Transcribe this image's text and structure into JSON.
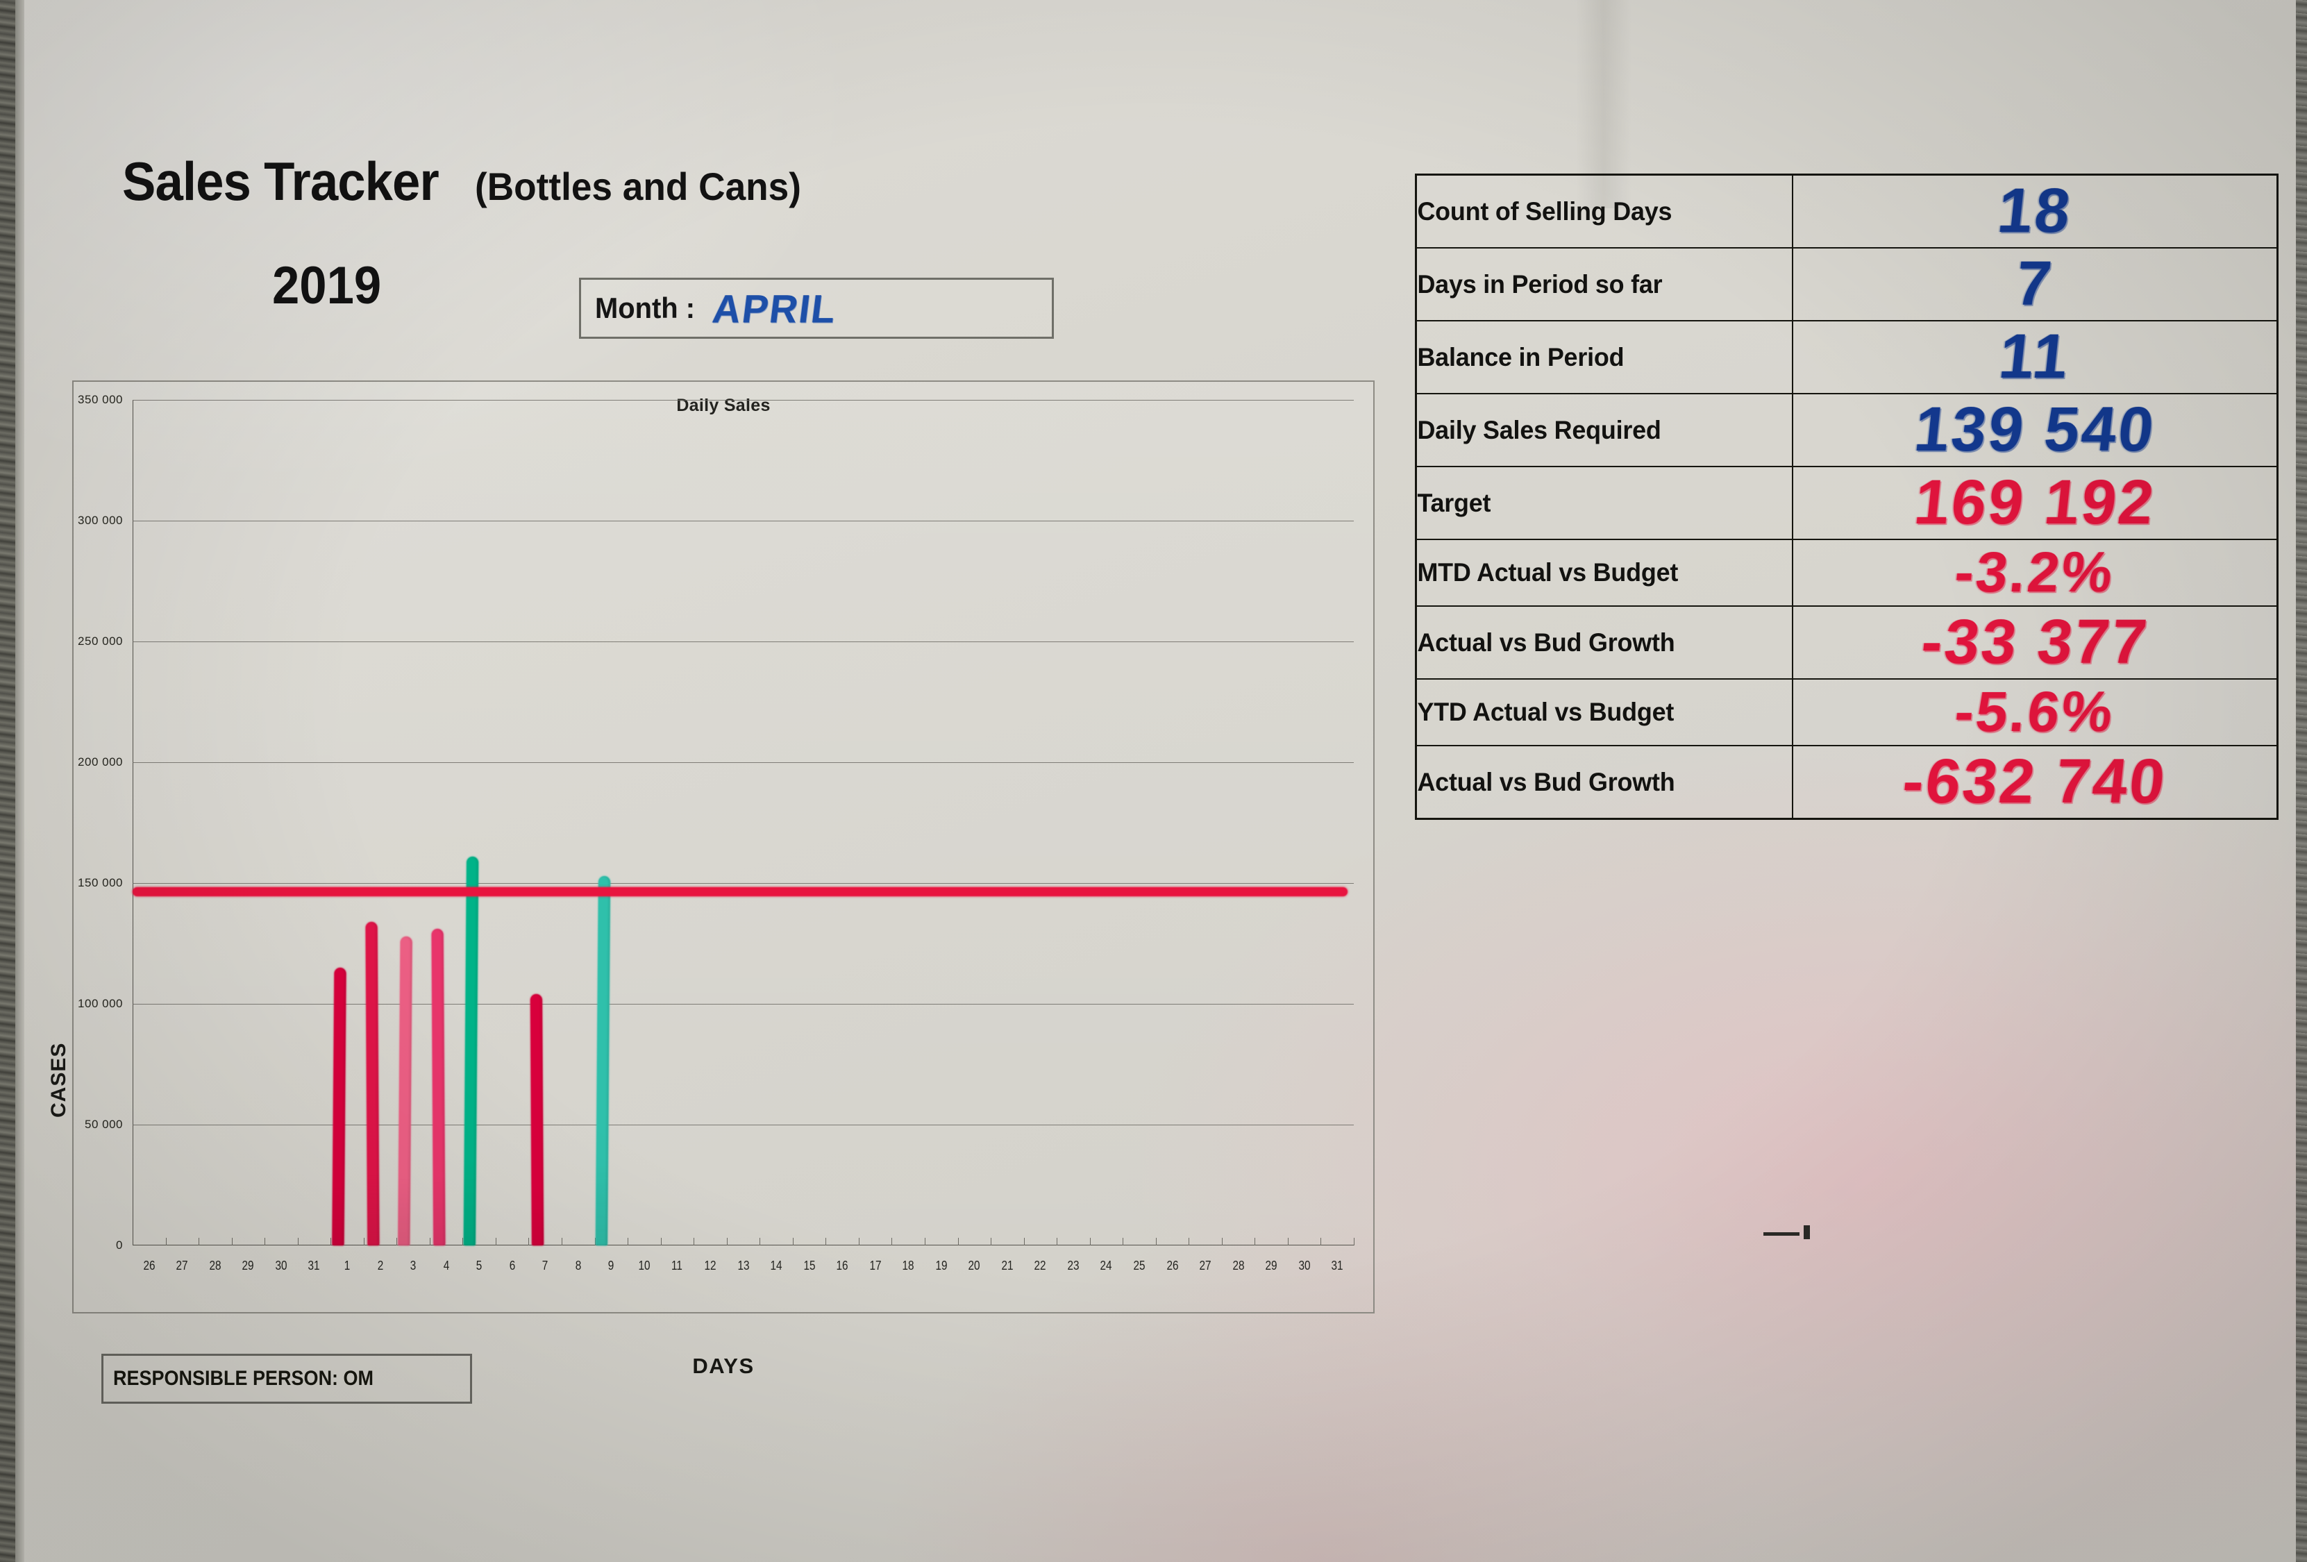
{
  "header": {
    "title_main": "Sales Tracker",
    "title_sub": "(Bottles and Cans)",
    "year": "2019",
    "month_label": "Month :",
    "month_value": "APRIL"
  },
  "chart_panel": {
    "responsible_person": "RESPONSIBLE PERSON: OM"
  },
  "metrics": {
    "rows": [
      {
        "label": "Count of Selling Days",
        "value": "18",
        "ink": "blue"
      },
      {
        "label": "Days in Period so far",
        "value": "7",
        "ink": "blue"
      },
      {
        "label": "Balance in Period",
        "value": "11",
        "ink": "blue"
      },
      {
        "label": "Daily Sales Required",
        "value": "139 540",
        "ink": "blue"
      },
      {
        "label": "Target",
        "value": "169 192",
        "ink": "red"
      },
      {
        "label": "MTD Actual vs Budget",
        "value": "-3.2%",
        "ink": "red"
      },
      {
        "label": "Actual vs Bud Growth",
        "value": "-33 377",
        "ink": "red"
      },
      {
        "label": "YTD Actual vs Budget",
        "value": "-5.6%",
        "ink": "red"
      },
      {
        "label": "Actual vs Bud Growth",
        "value": "-632 740",
        "ink": "red"
      }
    ]
  },
  "colors": {
    "ink_blue": "#13398f",
    "ink_red": "#e0143c",
    "marker_pink": "#e8356b",
    "marker_crimson": "#d8003c",
    "marker_green": "#00b388",
    "marker_teal": "#2fc0ab",
    "target_line": "#e8143f",
    "board": "#d9d7d1"
  },
  "chart_data": {
    "type": "bar",
    "title": "Daily Sales",
    "xlabel": "DAYS",
    "ylabel": "CASES",
    "ylim": [
      0,
      350000
    ],
    "yticks": [
      0,
      50000,
      100000,
      150000,
      200000,
      250000,
      300000,
      350000
    ],
    "ytick_labels": [
      "0",
      "50 000",
      "100 000",
      "150 000",
      "200 000",
      "250 000",
      "300 000",
      "350 000"
    ],
    "grid": true,
    "legend": "none",
    "categories": [
      "26",
      "27",
      "28",
      "29",
      "30",
      "31",
      "1",
      "2",
      "3",
      "4",
      "5",
      "6",
      "7",
      "8",
      "9",
      "10",
      "11",
      "12",
      "13",
      "14",
      "15",
      "16",
      "17",
      "18",
      "19",
      "20",
      "21",
      "22",
      "23",
      "24",
      "25",
      "26",
      "27",
      "28",
      "29",
      "30",
      "31"
    ],
    "target_line": {
      "label": "Daily Sales Required",
      "value": 147000,
      "color": "#e8143f",
      "x_start": "26",
      "x_end": "31"
    },
    "bars": [
      {
        "day": "1",
        "value": 115000,
        "color": "#d8003c",
        "note": "handwritten marker bar"
      },
      {
        "day": "2",
        "value": 134000,
        "color": "#e01448",
        "note": "handwritten marker bar"
      },
      {
        "day": "3",
        "value": 128000,
        "color": "#ec5f84",
        "note": "handwritten marker bar"
      },
      {
        "day": "4",
        "value": 131000,
        "color": "#e8356b",
        "note": "handwritten marker bar"
      },
      {
        "day": "5",
        "value": 161000,
        "color": "#00b388",
        "note": "handwritten marker bar, above target"
      },
      {
        "day": "7",
        "value": 104000,
        "color": "#d8003c",
        "note": "handwritten marker bar"
      },
      {
        "day": "9",
        "value": 153000,
        "color": "#2fc0ab",
        "note": "handwritten marker bar, above target"
      }
    ],
    "values": [
      null,
      null,
      null,
      null,
      null,
      null,
      115000,
      134000,
      128000,
      131000,
      161000,
      null,
      104000,
      null,
      153000,
      null,
      null,
      null,
      null,
      null,
      null,
      null,
      null,
      null,
      null,
      null,
      null,
      null,
      null,
      null,
      null,
      null,
      null,
      null,
      null,
      null,
      null
    ]
  }
}
